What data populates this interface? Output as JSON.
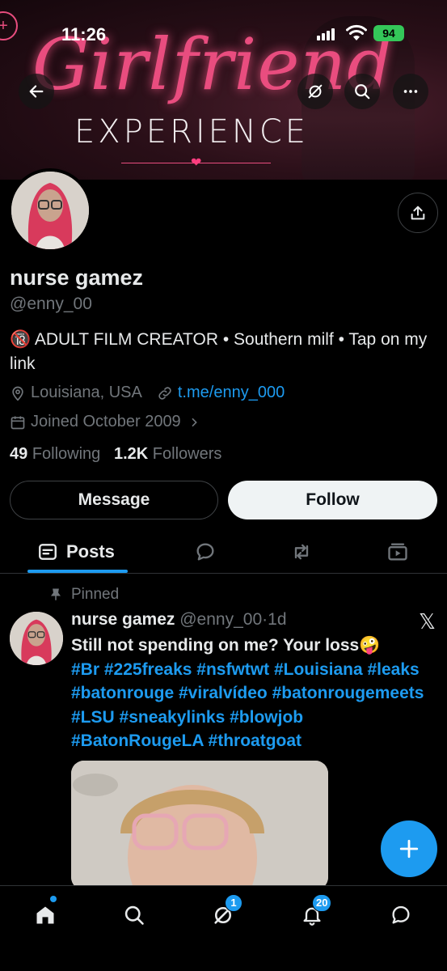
{
  "status_bar": {
    "time": "11:26",
    "battery": "94"
  },
  "banner": {
    "title": "Girlfriend",
    "subtitle": "EXPERIENCE"
  },
  "profile": {
    "name": "nurse gamez",
    "handle": "@enny_00",
    "bio_emoji": "🔞",
    "bio": "ADULT FILM CREATOR • Southern milf • Tap on my link",
    "location": "Louisiana, USA",
    "link": "t.me/enny_000",
    "joined": "Joined October 2009",
    "following_count": "49",
    "following_label": "Following",
    "followers_count": "1.2K",
    "followers_label": "Followers"
  },
  "actions": {
    "message_label": "Message",
    "follow_label": "Follow"
  },
  "tabs": {
    "posts_label": "Posts"
  },
  "post": {
    "pinned_label": "Pinned",
    "author_name": "nurse gamez",
    "author_handle": "@enny_00",
    "sep": "·",
    "time": "1d",
    "text": "Still not spending on me? Your loss🤪",
    "hashtags": "#Br #225freaks #nsfwtwt #Louisiana #leaks #batonrouge #viralvídeo #batonrougemeets #LSU #sneakylinks #blowjob #BatonRougeLA #throatgoat"
  },
  "bottom_nav": {
    "grok_badge": "1",
    "notifications_badge": "20"
  },
  "icons": [
    "back-icon",
    "grok-icon",
    "search-icon",
    "more-icon",
    "share-icon",
    "location-icon",
    "link-icon",
    "calendar-icon",
    "posts-icon",
    "replies-icon",
    "repost-icon",
    "media-icon",
    "pin-icon",
    "x-logo-icon",
    "plus-icon",
    "home-icon",
    "bell-icon",
    "messages-icon"
  ],
  "colors": {
    "accent": "#1d9bf0",
    "background": "#000000",
    "text": "#e7e9ea",
    "secondary": "#71767b"
  }
}
